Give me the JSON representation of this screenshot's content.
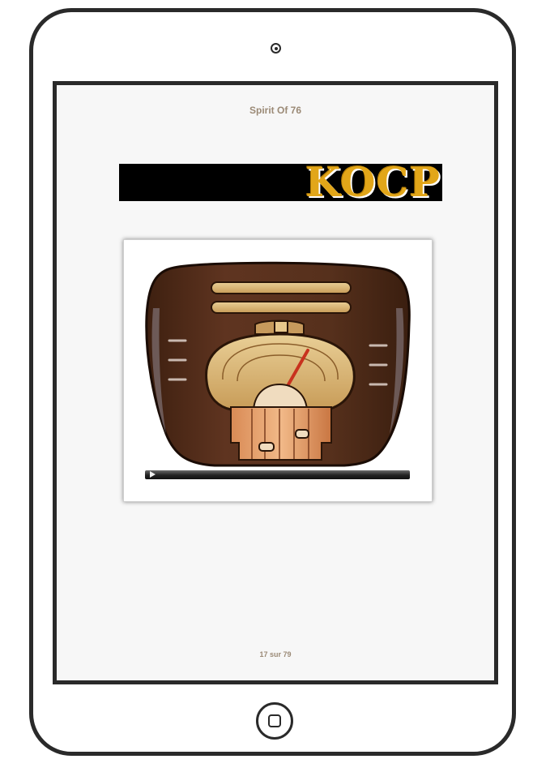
{
  "page": {
    "title": "Spirit Of 76",
    "banner_text": "KOCP",
    "counter": "17 sur 79"
  },
  "colors": {
    "device_frame": "#2a2a2a",
    "screen_bg": "#f7f7f7",
    "title_text": "#9b8a76",
    "banner_bg": "#000000",
    "banner_text": "#e2a619",
    "radio_wood": "#5a301b"
  },
  "icons": {
    "camera": "camera-icon",
    "play": "play-icon",
    "home": "home-button-icon",
    "radio": "vintage-radio-illustration"
  }
}
